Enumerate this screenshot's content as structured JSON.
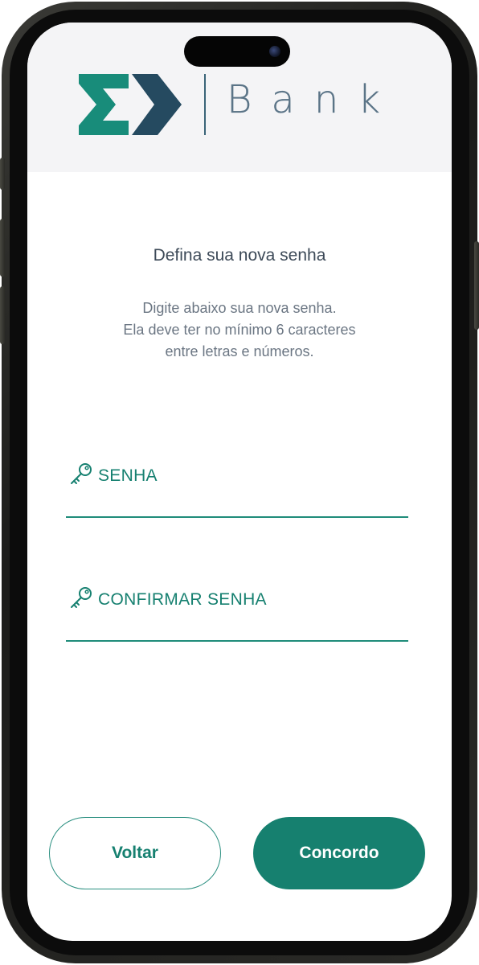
{
  "brand": {
    "name": "Bank",
    "colors": {
      "primary": "#16806f",
      "dark": "#254a60",
      "logo_teal": "#188c7a"
    }
  },
  "header": {
    "logo_icon": "sigma-arrow-logo"
  },
  "main": {
    "title": "Defina sua nova senha",
    "description_lines": [
      "Digite abaixo sua nova senha.",
      "Ela deve ter no mínimo 6 caracteres",
      "entre letras e números."
    ]
  },
  "form": {
    "password": {
      "label": "SENHA",
      "icon": "key-icon",
      "value": ""
    },
    "confirm": {
      "label": "CONFIRMAR SENHA",
      "icon": "key-icon",
      "value": ""
    }
  },
  "actions": {
    "back_label": "Voltar",
    "agree_label": "Concordo"
  }
}
